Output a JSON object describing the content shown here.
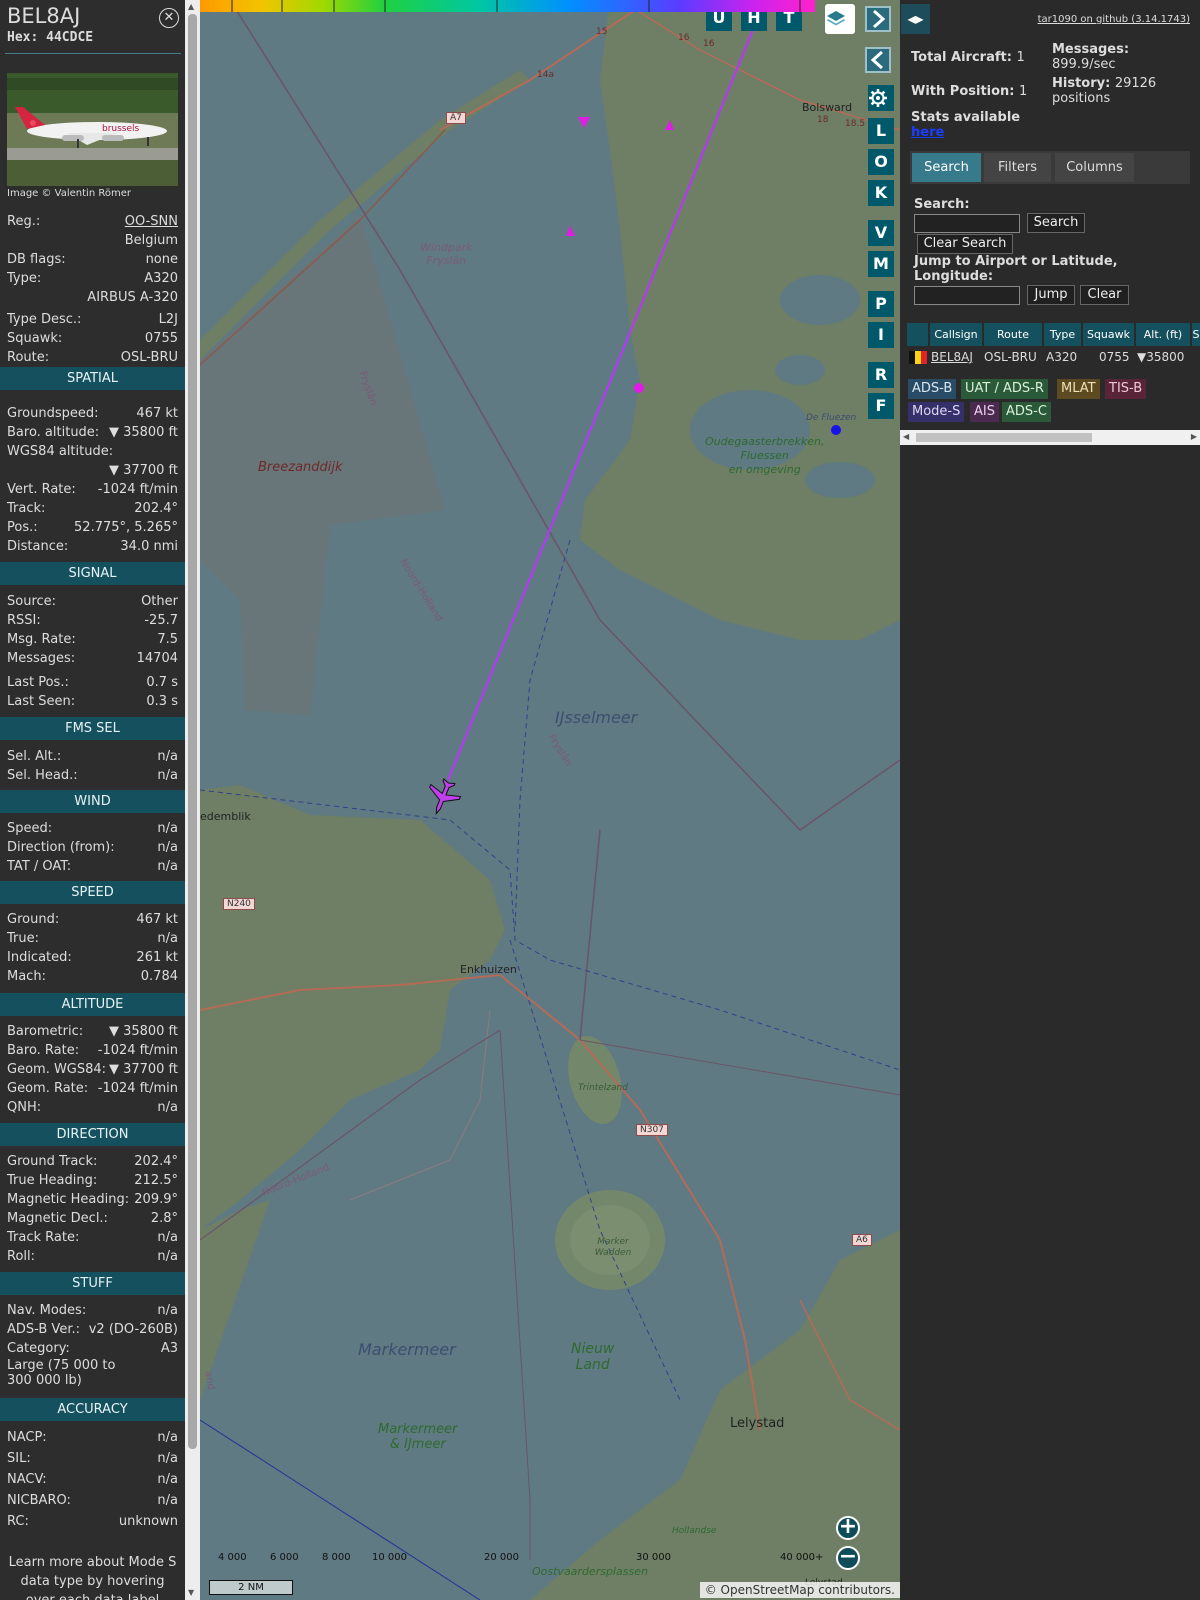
{
  "info": {
    "callsign": "BEL8AJ",
    "hex": "Hex: 44CDCE",
    "photo_credit": "Image © Valentin Römer",
    "photo_livery_text": "brussels",
    "rows_top": [
      {
        "k": "Reg.:",
        "v": "OO-SNN"
      },
      {
        "k": "",
        "v": "Belgium"
      },
      {
        "k": "DB flags:",
        "v": "none"
      },
      {
        "k": "Type:",
        "v": "A320"
      },
      {
        "k": "",
        "v": "AIRBUS A-320"
      },
      {
        "k": "Type Desc.:",
        "v": "L2J"
      },
      {
        "k": "Squawk:",
        "v": "0755"
      },
      {
        "k": "Route:",
        "v": "OSL-BRU"
      }
    ],
    "sections": {
      "spatial": "SPATIAL",
      "signal": "SIGNAL",
      "fms": "FMS SEL",
      "wind": "WIND",
      "speed": "SPEED",
      "altitude": "ALTITUDE",
      "direction": "DIRECTION",
      "stuff": "STUFF",
      "accuracy": "ACCURACY"
    },
    "spatial": [
      {
        "k": "Groundspeed:",
        "v": "467 kt"
      },
      {
        "k": "Baro. altitude:",
        "v": "▼ 35800 ft"
      },
      {
        "k": "WGS84 altitude:",
        "v": ""
      },
      {
        "k": "",
        "v": "▼ 37700 ft"
      },
      {
        "k": "Vert. Rate:",
        "v": "-1024 ft/min"
      },
      {
        "k": "Track:",
        "v": "202.4°"
      },
      {
        "k": "Pos.:",
        "v": "52.775°, 5.265°"
      },
      {
        "k": "Distance:",
        "v": "34.0 nmi"
      }
    ],
    "signal": [
      {
        "k": "Source:",
        "v": "Other"
      },
      {
        "k": "RSSI:",
        "v": "-25.7"
      },
      {
        "k": "Msg. Rate:",
        "v": "7.5"
      },
      {
        "k": "Messages:",
        "v": "14704"
      },
      {
        "k": "Last Pos.:",
        "v": "0.7 s"
      },
      {
        "k": "Last Seen:",
        "v": "0.3 s"
      }
    ],
    "fms": [
      {
        "k": "Sel. Alt.:",
        "v": "n/a"
      },
      {
        "k": "Sel. Head.:",
        "v": "n/a"
      }
    ],
    "wind": [
      {
        "k": "Speed:",
        "v": "n/a"
      },
      {
        "k": "Direction (from):",
        "v": "n/a"
      },
      {
        "k": "TAT / OAT:",
        "v": "n/a"
      }
    ],
    "speed": [
      {
        "k": "Ground:",
        "v": "467 kt"
      },
      {
        "k": "True:",
        "v": "n/a"
      },
      {
        "k": "Indicated:",
        "v": "261 kt"
      },
      {
        "k": "Mach:",
        "v": "0.784"
      }
    ],
    "altitude": [
      {
        "k": "Barometric:",
        "v": "▼ 35800 ft"
      },
      {
        "k": "Baro. Rate:",
        "v": "-1024 ft/min"
      },
      {
        "k": "Geom. WGS84:",
        "v": "▼ 37700 ft"
      },
      {
        "k": "Geom. Rate:",
        "v": "-1024 ft/min"
      },
      {
        "k": "QNH:",
        "v": "n/a"
      }
    ],
    "direction": [
      {
        "k": "Ground Track:",
        "v": "202.4°"
      },
      {
        "k": "True Heading:",
        "v": "212.5°"
      },
      {
        "k": "Magnetic Heading:",
        "v": "209.9°"
      },
      {
        "k": "Magnetic Decl.:",
        "v": "2.8°"
      },
      {
        "k": "Track Rate:",
        "v": "n/a"
      },
      {
        "k": "Roll:",
        "v": "n/a"
      }
    ],
    "stuff": [
      {
        "k": "Nav. Modes:",
        "v": "n/a"
      },
      {
        "k": "ADS-B Ver.:",
        "v": "v2 (DO-260B)"
      },
      {
        "k": "Category:",
        "v": "A3"
      }
    ],
    "category_desc_1": "Large (75 000 to",
    "category_desc_2": "300 000 lb)",
    "accuracy": [
      {
        "k": "NACP:",
        "v": "n/a"
      },
      {
        "k": "SIL:",
        "v": "n/a"
      },
      {
        "k": "NACV:",
        "v": "n/a"
      },
      {
        "k": "NICBARO:",
        "v": "n/a"
      },
      {
        "k": "RC:",
        "v": "unknown"
      }
    ],
    "learn_more": "Learn more about Mode S data type by hovering over each data label"
  },
  "map": {
    "buttons": [
      "U",
      "H",
      "T",
      "L",
      "O",
      "K",
      "V",
      "M",
      "P",
      "I",
      "R",
      "F"
    ],
    "labels": {
      "windpark": "Windpark",
      "fryslan_wp": "Fryslân",
      "breezanddijk": "Breezanddijk",
      "noord_holland": "Noord-Holland",
      "fryslan1": "Fryslân",
      "fryslan2": "Fryslân",
      "ijsselmeer": "IJsselmeer",
      "medemblik": "edemblik",
      "enkhuizen": "Enkhuizen",
      "trintelzand": "Trintelzand",
      "marker_wadden": "Marker Wadden",
      "markermeer": "Markermeer",
      "markermeer_ijmeer_1": "Markermeer",
      "markermeer_ijmeer_2": "& IJmeer",
      "nieuw_land_1": "Nieuw",
      "nieuw_land_2": "Land",
      "lelystad": "Lelystad",
      "oostvaardersplassen": "Oostvaardersplassen",
      "hollandse": "Hollandse",
      "lelystad_small": "Lelystad",
      "bolsward": "Bolsward",
      "de_fluezen": "De Fluezen",
      "oudegaasterbrekken_1": "Oudegaasterbrekken,",
      "oudegaasterbrekken_2": "Fluessen",
      "oudegaasterbrekken_3": "en omgeving",
      "noord_holland_2": "Noord-Holland",
      "land_short": "and",
      "a7": "A7",
      "n240": "N240",
      "n307": "N307",
      "a6": "A6",
      "r14a": "14a",
      "r15": "15",
      "r16": "16",
      "r16b": "16",
      "r18": "18",
      "r18b": "18.5"
    },
    "colorbar_ticks": [
      "4 000",
      "6 000",
      "8 000",
      "10 000",
      "20 000",
      "30 000",
      "40 000+"
    ],
    "scale": "2 NM",
    "attribution": "© OpenStreetMap contributors."
  },
  "sidebar": {
    "github": "tar1090 on github (3.14.1743)",
    "total_aircraft_label": "Total Aircraft:",
    "total_aircraft": "1",
    "with_position_label": "With Position:",
    "with_position": "1",
    "stats_label": "Stats available",
    "stats_link": "here",
    "messages_label": "Messages:",
    "messages_rate": "899.9/sec",
    "history_label": "History:",
    "history_value": "29126",
    "history_unit": "positions",
    "tabs": [
      "Search",
      "Filters",
      "Columns"
    ],
    "search_label": "Search:",
    "search_btn": "Search",
    "clear_search_btn": "Clear Search",
    "jump_label_1": "Jump to Airport or Latitude,",
    "jump_label_2": "Longitude:",
    "jump_btn": "Jump",
    "clear_btn": "Clear",
    "columns": [
      "Callsign",
      "Route",
      "Type",
      "Squawk",
      "Alt. (ft)",
      "S"
    ],
    "row": {
      "callsign": "BEL8AJ",
      "route": "OSL-BRU",
      "type": "A320",
      "squawk": "0755",
      "alt": "▼35800"
    },
    "chips": [
      "ADS-B",
      "UAT / ADS-R",
      "MLAT",
      "TIS-B",
      "Mode-S",
      "AIS",
      "ADS-C"
    ]
  },
  "colors": {
    "panel_bg": "#2d2d2d",
    "section_header": "#15505e",
    "map_water": "#5f7a82",
    "map_land": "#6f8068",
    "track": "#bb33ff",
    "aircraft": "#c040f0"
  }
}
